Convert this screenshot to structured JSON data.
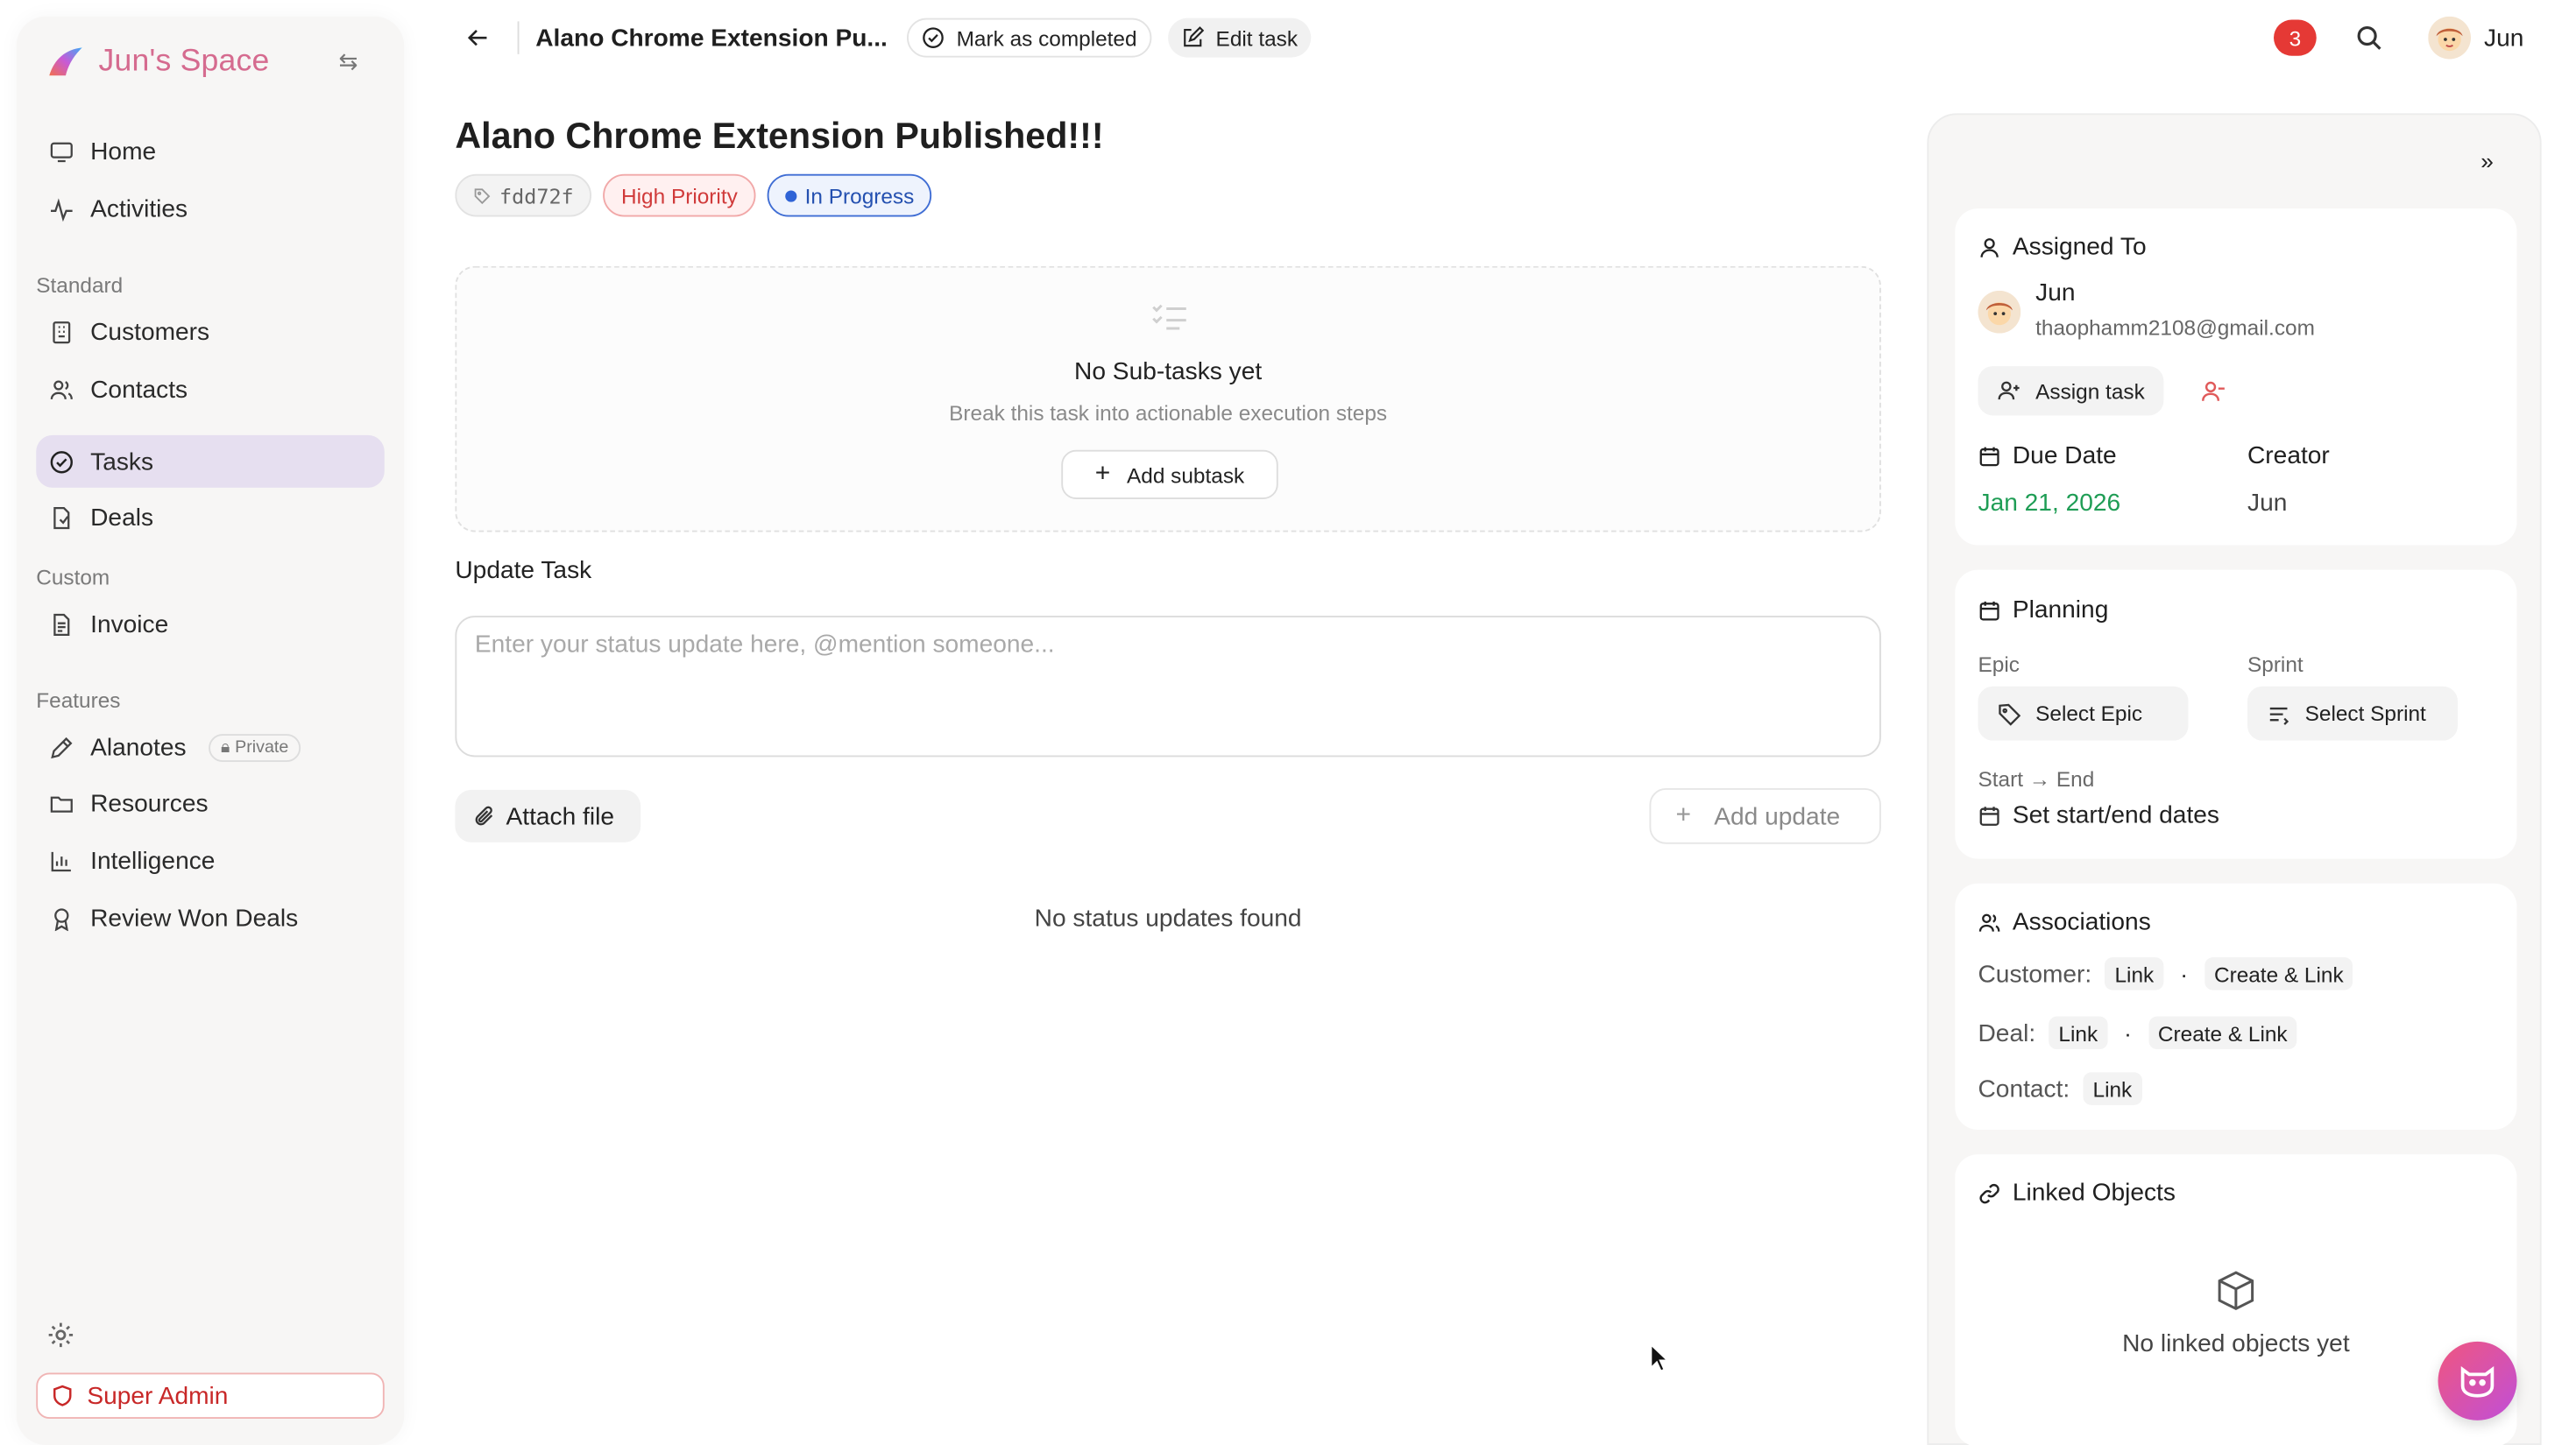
{
  "sidebar": {
    "brand": "Jun's Space",
    "nav_main": [
      {
        "label": "Home",
        "icon": "monitor-icon"
      },
      {
        "label": "Activities",
        "icon": "activity-icon"
      }
    ],
    "section_standard": "Standard",
    "nav_standard": [
      {
        "label": "Customers",
        "icon": "building-icon"
      },
      {
        "label": "Contacts",
        "icon": "users-icon"
      },
      {
        "label": "Tasks",
        "icon": "check-circle-icon",
        "active": true
      },
      {
        "label": "Deals",
        "icon": "document-icon"
      }
    ],
    "section_custom": "Custom",
    "nav_custom": [
      {
        "label": "Invoice",
        "icon": "file-text-icon"
      }
    ],
    "section_features": "Features",
    "nav_features": [
      {
        "label": "Alanotes",
        "icon": "pen-icon",
        "badge": "Private"
      },
      {
        "label": "Resources",
        "icon": "folder-icon"
      },
      {
        "label": "Intelligence",
        "icon": "bar-chart-icon"
      },
      {
        "label": "Review Won Deals",
        "icon": "award-icon"
      }
    ],
    "super_admin": "Super Admin"
  },
  "topbar": {
    "breadcrumb_title": "Alano Chrome Extension Pu...",
    "mark_completed": "Mark as completed",
    "edit_task": "Edit task",
    "notification_count": "3",
    "user_name": "Jun"
  },
  "task": {
    "title": "Alano Chrome Extension Published!!!",
    "id": "fdd72f",
    "priority": "High Priority",
    "status": "In Progress"
  },
  "subtasks": {
    "empty_title": "No Sub-tasks yet",
    "empty_subtitle": "Break this task into actionable execution steps",
    "add_label": "Add subtask"
  },
  "update": {
    "label": "Update Task",
    "placeholder": "Enter your status update here, @mention someone...",
    "attach_label": "Attach file",
    "add_label": "Add update",
    "empty": "No status updates found"
  },
  "details": {
    "assigned_to": {
      "title": "Assigned To",
      "name": "Jun",
      "email": "thaophamm2108@gmail.com",
      "assign_label": "Assign task"
    },
    "due_date_label": "Due Date",
    "due_date_value": "Jan 21, 2026",
    "creator_label": "Creator",
    "creator_value": "Jun"
  },
  "planning": {
    "title": "Planning",
    "epic_label": "Epic",
    "epic_button": "Select Epic",
    "sprint_label": "Sprint",
    "sprint_button": "Select Sprint",
    "dates_label": "Start → End",
    "dates_button": "Set start/end dates"
  },
  "associations": {
    "title": "Associations",
    "customer_label": "Customer:",
    "deal_label": "Deal:",
    "contact_label": "Contact:",
    "link_label": "Link",
    "create_link_label": "Create & Link"
  },
  "linked_objects": {
    "title": "Linked Objects",
    "empty": "No linked objects yet"
  },
  "colors": {
    "brand": "#d56b8f",
    "active_nav": "#e6dff0",
    "priority": "#d03a3a",
    "status": "#2450b0",
    "due_date": "#1f9d55",
    "danger": "#c82828"
  }
}
